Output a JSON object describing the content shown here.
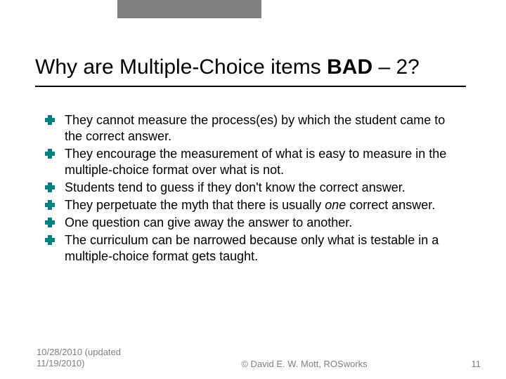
{
  "title": {
    "prefix": "Why are Multiple-Choice items ",
    "bad": "BAD",
    "suffix": " – 2?"
  },
  "bullets": [
    "They cannot measure the process(es) by which the student came to the correct answer.",
    "They encourage the measurement of what is easy to measure in the multiple-choice format over what is not.",
    "Students tend to guess if they don't know the correct answer.",
    "They perpetuate the myth that there is usually one correct answer.",
    "One question can give away the answer to another.",
    "The curriculum can be narrowed because only what is testable in a multiple-choice format gets taught."
  ],
  "footer": {
    "date": "10/28/2010 (updated 11/19/2010)",
    "copyright": "© David E. W. Mott, ROSworks",
    "page": "11"
  },
  "colors": {
    "bullet_accent": "#008080",
    "footer_text": "#808080",
    "top_bar": "#808080"
  }
}
